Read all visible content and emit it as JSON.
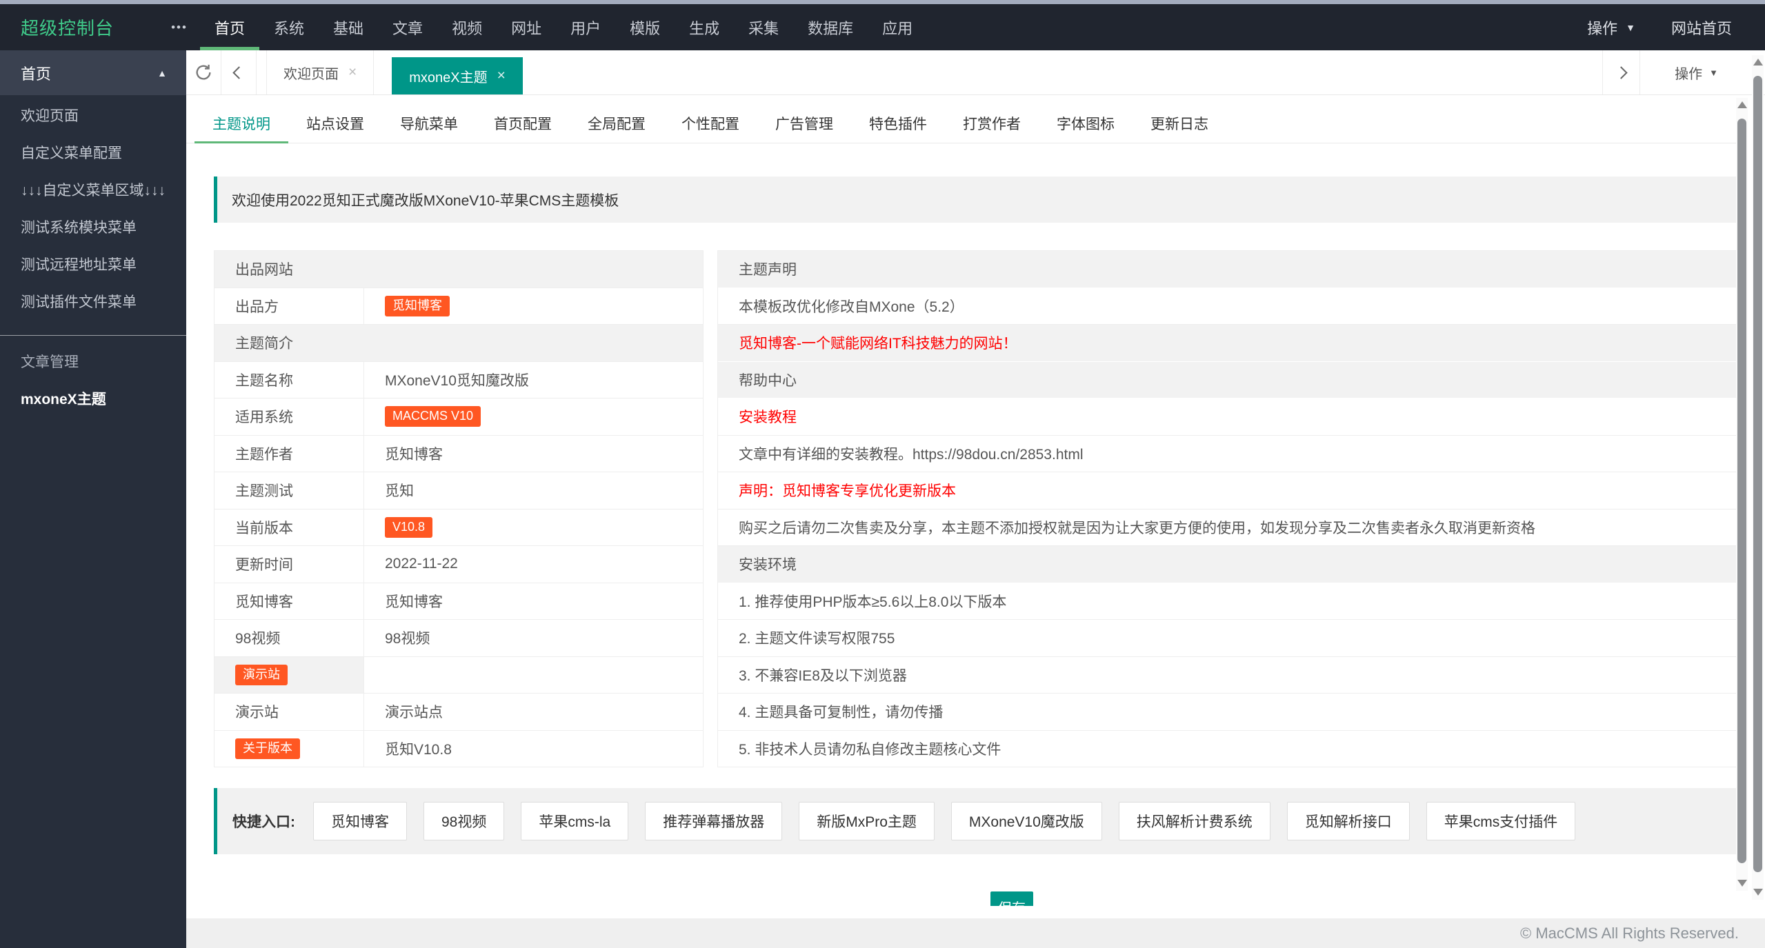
{
  "topbar": {
    "brand": "超级控制台",
    "more_icon": "•••",
    "nav": [
      {
        "label": "首页",
        "active": true
      },
      {
        "label": "系统"
      },
      {
        "label": "基础"
      },
      {
        "label": "文章"
      },
      {
        "label": "视频"
      },
      {
        "label": "网址"
      },
      {
        "label": "用户"
      },
      {
        "label": "模版"
      },
      {
        "label": "生成"
      },
      {
        "label": "采集"
      },
      {
        "label": "数据库"
      },
      {
        "label": "应用"
      }
    ],
    "action_label": "操作",
    "site_home_label": "网站首页"
  },
  "sidebar": {
    "section_title": "首页",
    "items": [
      {
        "label": "欢迎页面"
      },
      {
        "label": "自定义菜单配置"
      },
      {
        "label": "↓↓↓自定义菜单区域↓↓↓"
      },
      {
        "label": "测试系统模块菜单"
      },
      {
        "label": "测试远程地址菜单"
      },
      {
        "label": "测试插件文件菜单"
      }
    ],
    "lower_items": [
      {
        "label": "文章管理",
        "dim": true
      },
      {
        "label": "mxoneX主题",
        "active": true
      }
    ]
  },
  "tabbar": {
    "close_icon": "×",
    "tabs": [
      {
        "label": "欢迎页面"
      },
      {
        "label": "mxoneX主题",
        "active": true
      }
    ],
    "action_label": "操作"
  },
  "content_tabs": [
    {
      "label": "主题说明",
      "active": true
    },
    {
      "label": "站点设置"
    },
    {
      "label": "导航菜单"
    },
    {
      "label": "首页配置"
    },
    {
      "label": "全局配置"
    },
    {
      "label": "个性配置"
    },
    {
      "label": "广告管理"
    },
    {
      "label": "特色插件"
    },
    {
      "label": "打赏作者"
    },
    {
      "label": "字体图标"
    },
    {
      "label": "更新日志"
    }
  ],
  "alert": {
    "text": "欢迎使用2022觅知正式魔改版MXoneV10-苹果CMS主题模板"
  },
  "info_table": {
    "rows": [
      {
        "section": true,
        "label": "出品网站"
      },
      {
        "label": "出品方",
        "value": "觅知博客",
        "value_badge": true
      },
      {
        "section": true,
        "label": "主题简介"
      },
      {
        "label": "主题名称",
        "value": "MXoneV10觅知魔改版"
      },
      {
        "label": "适用系统",
        "value": "MACCMS V10",
        "value_badge": true
      },
      {
        "label": "主题作者",
        "value": "觅知博客"
      },
      {
        "label": "主题测试",
        "value": "觅知"
      },
      {
        "label": "当前版本",
        "value": "V10.8",
        "value_badge": true
      },
      {
        "label": "更新时间",
        "value": "2022-11-22"
      },
      {
        "label": "觅知博客",
        "value": "觅知博客"
      },
      {
        "label": "98视频",
        "value": "98视频"
      },
      {
        "label": "演示站",
        "label_badge": true,
        "label_gray": true,
        "value": ""
      },
      {
        "label": "演示站",
        "value": "演示站点"
      },
      {
        "label": "关于版本",
        "label_badge": true,
        "value": "觅知V10.8"
      }
    ]
  },
  "notes_table": {
    "rows": [
      {
        "text": "主题声明",
        "gray": true
      },
      {
        "text": "本模板改优化修改自MXone（5.2）"
      },
      {
        "text": "觅知博客-一个赋能网络IT科技魅力的网站！",
        "red": true,
        "gray": true
      },
      {
        "text": "帮助中心",
        "gray": true
      },
      {
        "text": "安装教程",
        "red": true
      },
      {
        "text": "文章中有详细的安装教程。https://98dou.cn/2853.html"
      },
      {
        "text": "声明：觅知博客专享优化更新版本",
        "red": true
      },
      {
        "text": "购买之后请勿二次售卖及分享，本主题不添加授权就是因为让大家更方便的使用，如发现分享及二次售卖者永久取消更新资格"
      },
      {
        "text": "安装环境",
        "gray": true
      },
      {
        "text": "1. 推荐使用PHP版本≥5.6以上8.0以下版本"
      },
      {
        "text": "2. 主题文件读写权限755"
      },
      {
        "text": "3. 不兼容IE8及以下浏览器"
      },
      {
        "text": "4. 主题具备可复制性，请勿传播"
      },
      {
        "text": "5. 非技术人员请勿私自修改主题核心文件"
      }
    ]
  },
  "quick_links": {
    "label": "快捷入口:",
    "buttons": [
      "觅知博客",
      "98视频",
      "苹果cms-la",
      "推荐弹幕播放器",
      "新版MxPro主题",
      "MXoneV10魔改版",
      "扶风解析计费系统",
      "觅知解析接口",
      "苹果cms支付插件"
    ]
  },
  "save_button": "保存",
  "footer": "© MacCMS All Rights Reserved.",
  "colors": {
    "accent_green": "#5FB878",
    "accent_teal": "#009688",
    "badge_orange": "#FF5722",
    "alert_red": "#FF0000",
    "topbar_bg": "#20252F",
    "sidebar_bg": "#272E3B"
  }
}
